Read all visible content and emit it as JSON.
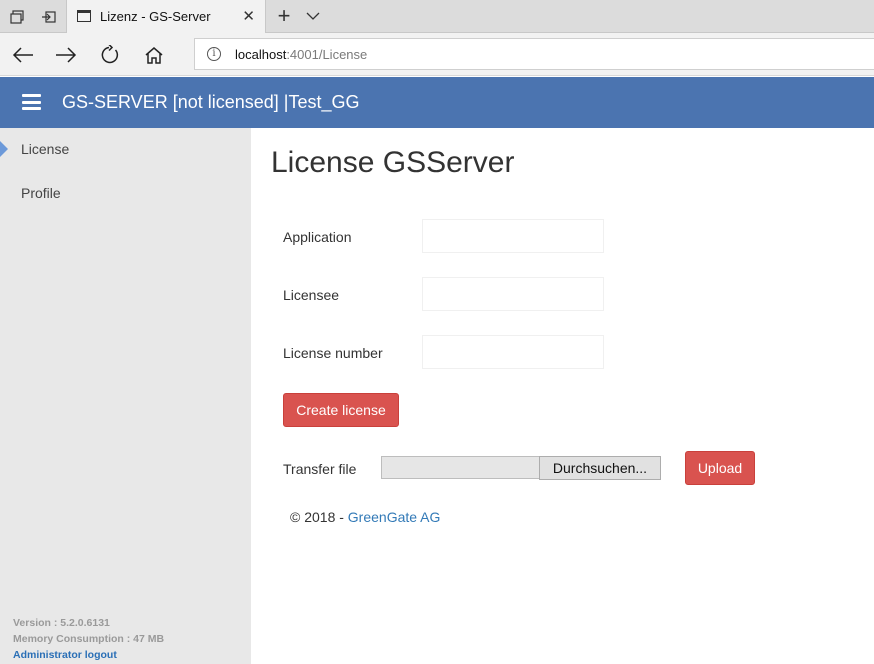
{
  "browser": {
    "tab_title": "Lizenz - GS-Server",
    "tab_close": "✕",
    "new_tab": "+",
    "address_host": "localhost",
    "address_path": ":4001/License",
    "info_glyph": "i",
    "icons": [
      "tab-preview-icon",
      "set-aside-tabs-icon",
      "page-favicon-icon",
      "close-icon",
      "new-tab-icon",
      "chevron-down-icon",
      "back-icon",
      "forward-icon",
      "refresh-icon",
      "home-icon",
      "info-icon"
    ]
  },
  "header": {
    "title": "GS-SERVER [not licensed] |Test_GG",
    "background": "#4b74b0"
  },
  "sidebar": {
    "items": [
      {
        "label": "License",
        "active": true
      },
      {
        "label": "Profile",
        "active": false
      }
    ],
    "version": "Version : 5.2.0.6131",
    "memory": "Memory Consumption : 47 MB",
    "logout": "Administrator logout"
  },
  "main": {
    "title": "License GSServer",
    "fields": [
      {
        "label": "Application",
        "value": ""
      },
      {
        "label": "Licensee",
        "value": ""
      },
      {
        "label": "License number",
        "value": ""
      }
    ],
    "create_button": "Create license",
    "transfer_label": "Transfer file",
    "browse_button": "Durchsuchen...",
    "upload_button": "Upload",
    "button_color": "#d9534f"
  },
  "footer": {
    "copyright_prefix": "© 2018 - ",
    "company": "GreenGate AG"
  }
}
